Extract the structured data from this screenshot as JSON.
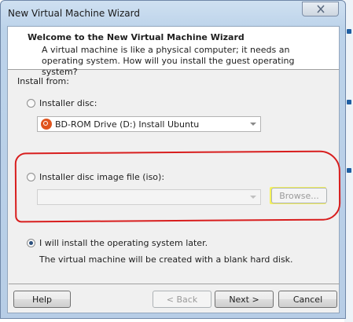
{
  "window": {
    "title": "New Virtual Machine Wizard"
  },
  "header": {
    "title": "Welcome to the New Virtual Machine Wizard",
    "description": "A virtual machine is like a physical computer; it needs an operating system. How will you install the guest operating system?"
  },
  "install_from": {
    "label": "Install from:",
    "options": [
      {
        "label": "Installer disc:",
        "selected": false
      },
      {
        "label": "Installer disc image file (iso):",
        "selected": false
      },
      {
        "label": "I will install the operating system later.",
        "selected": true
      }
    ],
    "disc_drive_value": "BD-ROM Drive (D:) Install Ubuntu",
    "iso_path_value": "",
    "browse_label": "Browse...",
    "later_note": "The virtual machine will be created with a blank hard disk."
  },
  "footer": {
    "help_label": "Help",
    "back_label": "< Back",
    "next_label": "Next >",
    "cancel_label": "Cancel"
  },
  "colors": {
    "annotation_outline": "#d81e1e",
    "highlight": "#f6f35c",
    "titlebar": "#bcd3ea"
  }
}
